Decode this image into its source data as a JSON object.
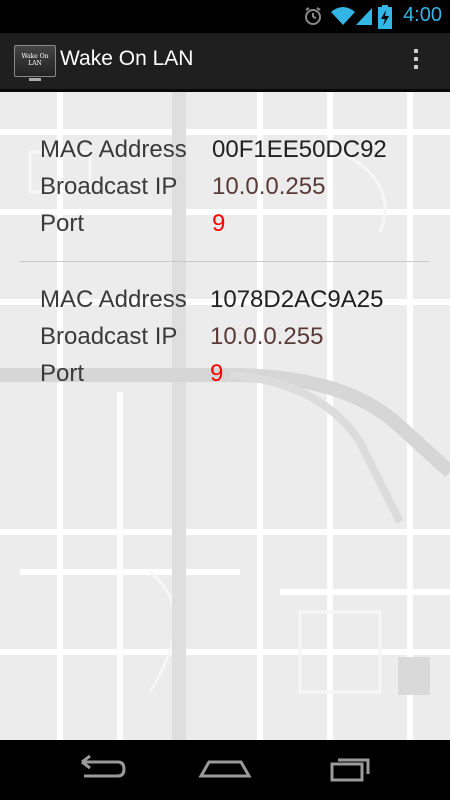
{
  "status_bar": {
    "time": "4:00",
    "icons": [
      "alarm-icon",
      "wifi-icon",
      "signal-icon",
      "battery-charging-icon"
    ],
    "accent_color": "#33b5e5"
  },
  "action_bar": {
    "app_icon_text": "Wake On LAN",
    "title": "Wake On LAN",
    "overflow_icon": "overflow-menu-icon"
  },
  "entries": [
    {
      "mac_label": "MAC Address",
      "mac_value": "00F1EE50DC92",
      "broadcast_label": "Broadcast IP",
      "broadcast_value": "10.0.0.255",
      "port_label": "Port",
      "port_value": "9"
    },
    {
      "mac_label": "MAC Address",
      "mac_value": "1078D2AC9A25",
      "broadcast_label": "Broadcast IP",
      "broadcast_value": "10.0.0.255",
      "port_label": "Port",
      "port_value": "9"
    }
  ],
  "colors": {
    "mac_value": "#202020",
    "broadcast_value": "#5a3a36",
    "port_value": "#ff0000"
  },
  "nav_bar": {
    "icons": [
      "back-icon",
      "home-icon",
      "recent-apps-icon"
    ]
  }
}
